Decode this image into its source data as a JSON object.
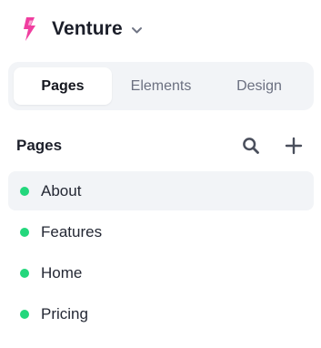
{
  "project": {
    "name": "Venture",
    "logo_icon": "lightning-bolt-icon",
    "brand_color": "#f03ea0",
    "menu_icon": "chevron-down-icon"
  },
  "tabs": [
    {
      "label": "Pages",
      "active": true
    },
    {
      "label": "Elements",
      "active": false
    },
    {
      "label": "Design",
      "active": false
    }
  ],
  "pages_section": {
    "title": "Pages",
    "search_icon": "search-icon",
    "add_icon": "plus-icon"
  },
  "pages": [
    {
      "label": "About",
      "selected": true,
      "status_color": "#23d77c"
    },
    {
      "label": "Features",
      "selected": false,
      "status_color": "#23d77c"
    },
    {
      "label": "Home",
      "selected": false,
      "status_color": "#23d77c"
    },
    {
      "label": "Pricing",
      "selected": false,
      "status_color": "#23d77c"
    }
  ]
}
